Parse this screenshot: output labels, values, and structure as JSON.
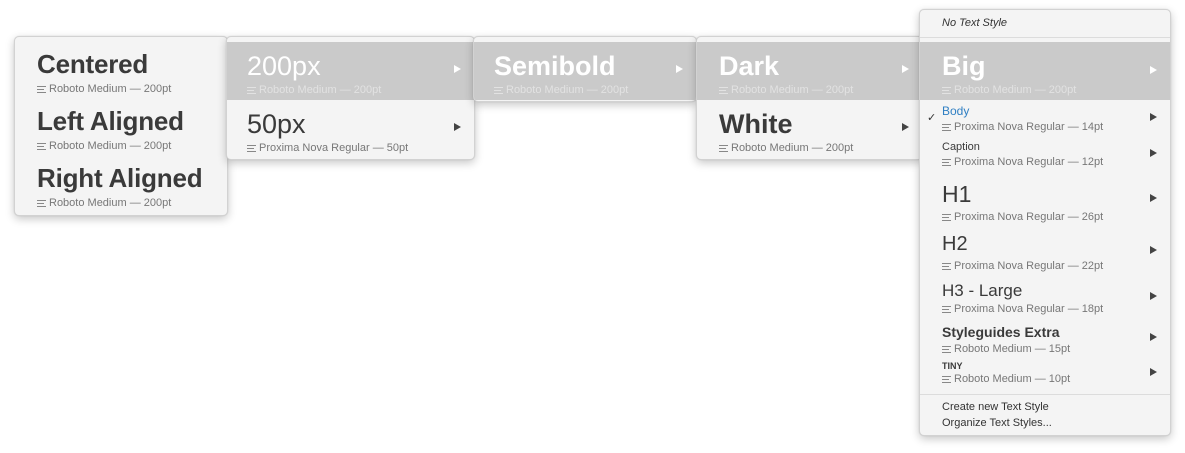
{
  "menu1": {
    "items": [
      {
        "title": "Centered",
        "meta": "Roboto Medium — 200pt"
      },
      {
        "title": "Left Aligned",
        "meta": "Roboto Medium — 200pt"
      },
      {
        "title": "Right Aligned",
        "meta": "Roboto Medium — 200pt"
      }
    ]
  },
  "menu2": {
    "items": [
      {
        "title": "200px",
        "meta": "Roboto Medium — 200pt"
      },
      {
        "title": "50px",
        "meta": "Proxima Nova Regular — 50pt"
      }
    ]
  },
  "menu3": {
    "items": [
      {
        "title": "Semibold",
        "meta": "Roboto Medium — 200pt"
      }
    ]
  },
  "menu4": {
    "items": [
      {
        "title": "Dark",
        "meta": "Roboto Medium — 200pt"
      },
      {
        "title": "White",
        "meta": "Roboto Medium — 200pt"
      }
    ]
  },
  "menu5": {
    "no_style": "No Text Style",
    "items": [
      {
        "title": "Big",
        "meta": "Roboto Medium — 200pt"
      },
      {
        "title": "Body",
        "meta": "Proxima Nova Regular — 14pt",
        "checked": true
      },
      {
        "title": "Caption",
        "meta": "Proxima Nova Regular — 12pt"
      },
      {
        "title": "H1",
        "meta": "Proxima Nova Regular — 26pt"
      },
      {
        "title": "H2",
        "meta": "Proxima Nova Regular — 22pt"
      },
      {
        "title": "H3 - Large",
        "meta": "Proxima Nova Regular — 18pt"
      },
      {
        "title": "Styleguides Extra",
        "meta": "Roboto Medium — 15pt"
      },
      {
        "title": "TINY",
        "meta": "Roboto Medium — 10pt"
      }
    ],
    "check_mark": "✓",
    "create_label": "Create new Text Style",
    "organize_label": "Organize Text Styles..."
  },
  "colors": {
    "selected_bg": "#cacaca",
    "body_title": "#2f7fc3",
    "menu_bg": "#f4f4f4"
  }
}
